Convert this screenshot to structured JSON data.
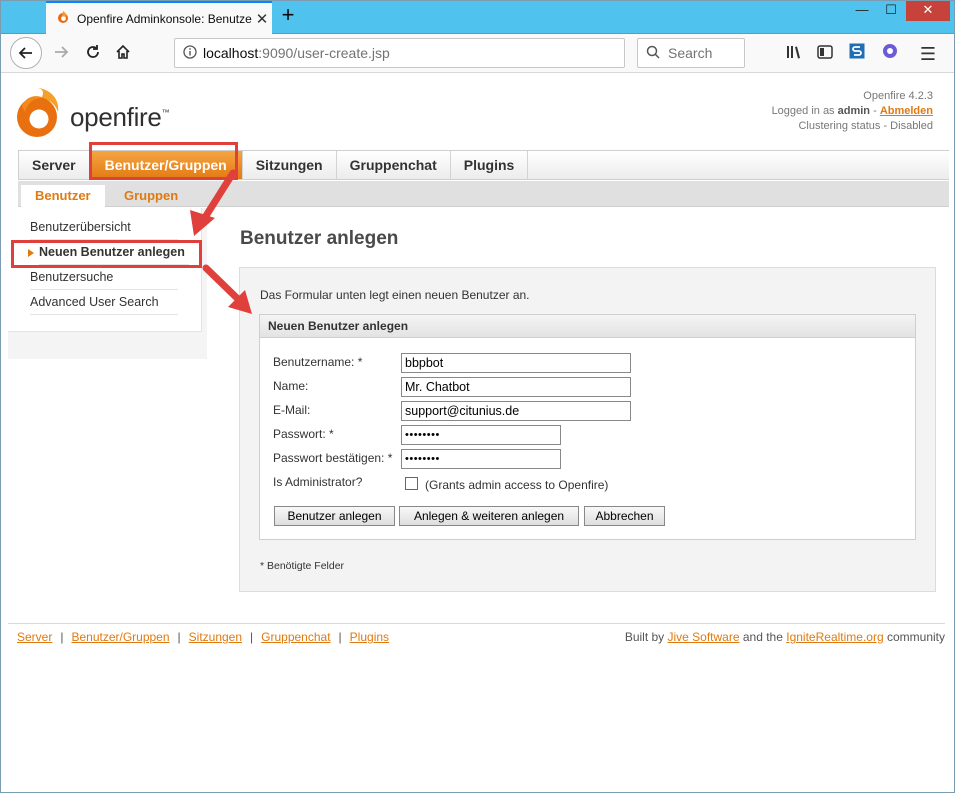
{
  "browser": {
    "tab_title": "Openfire Adminkonsole: Benutzer",
    "new_tab": "+",
    "url_host": "localhost",
    "url_path": ":9090/user-create.jsp",
    "search_placeholder": "Search",
    "window_controls": [
      "—",
      "☐",
      "✕"
    ]
  },
  "header": {
    "logo_text": "openfire",
    "logo_tm": "™",
    "version": "Openfire 4.2.3",
    "logged_in_prefix": "Logged in as ",
    "user": "admin",
    "dash": " - ",
    "logout": "Abmelden",
    "clustering": "Clustering status - Disabled"
  },
  "main_nav": [
    {
      "label": "Server",
      "active": false
    },
    {
      "label": "Benutzer/Gruppen",
      "active": true
    },
    {
      "label": "Sitzungen",
      "active": false
    },
    {
      "label": "Gruppenchat",
      "active": false
    },
    {
      "label": "Plugins",
      "active": false
    }
  ],
  "sub_nav": [
    {
      "label": "Benutzer",
      "active": true
    },
    {
      "label": "Gruppen",
      "active": false
    }
  ],
  "sidebar": [
    {
      "label": "Benutzerübersicht",
      "active": false
    },
    {
      "label": "Neuen Benutzer anlegen",
      "active": true
    },
    {
      "label": "Benutzersuche",
      "active": false
    },
    {
      "label": "Advanced User Search",
      "active": false
    }
  ],
  "page": {
    "title": "Benutzer anlegen",
    "intro": "Das Formular unten legt einen neuen Benutzer an.",
    "fieldset_title": "Neuen Benutzer anlegen",
    "required_note": "* Benötigte Felder"
  },
  "form": {
    "username_label": "Benutzername: *",
    "username_value": "bbpbot",
    "name_label": "Name:",
    "name_value": "Mr. Chatbot",
    "email_label": "E-Mail:",
    "email_value": "support@citunius.de",
    "password_label": "Passwort: *",
    "password_value": "••••••••",
    "password_confirm_label": "Passwort bestätigen: *",
    "password_confirm_value": "••••••••",
    "admin_label": "Is Administrator?",
    "admin_checked": false,
    "admin_hint": "(Grants admin access to Openfire)",
    "buttons": {
      "create": "Benutzer anlegen",
      "create_another": "Anlegen & weiteren anlegen",
      "cancel": "Abbrechen"
    }
  },
  "footer": {
    "links": [
      "Server",
      "Benutzer/Gruppen",
      "Sitzungen",
      "Gruppenchat",
      "Plugins"
    ],
    "separator": "|",
    "built_by": "Built by ",
    "jive": "Jive Software",
    "and_the": " and the ",
    "ignite": "IgniteRealtime.org",
    "community": " community"
  },
  "colors": {
    "accent_orange": "#e07a10",
    "titlebar_blue": "#4fc3ee",
    "annotation_red": "#e0403b"
  },
  "icons": [
    "openfire-flame-icon",
    "back-icon",
    "forward-icon",
    "reload-icon",
    "home-icon",
    "search-icon",
    "library-icon",
    "sidebar-icon",
    "bookmark-icon",
    "extension-icon",
    "menu-icon"
  ]
}
